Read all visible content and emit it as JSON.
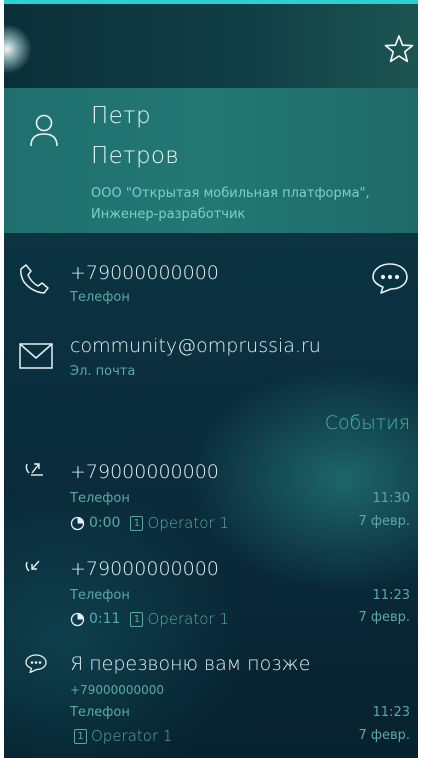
{
  "contact": {
    "first_name": "Петр",
    "last_name": "Петров",
    "company_line1": "ООО \"Открытая мобильная платформа\",",
    "company_line2": "Инженер-разработчик"
  },
  "details": {
    "phone_number": "+79000000000",
    "phone_label": "Телефон",
    "email": "community@omprussia.ru",
    "email_label": "Эл. почта"
  },
  "events_header": "События",
  "events": [
    {
      "type": "outgoing-call",
      "title": "+79000000000",
      "label": "Телефон",
      "duration": "0:00",
      "sim": "1",
      "operator": "Operator 1",
      "time": "11:30",
      "date": "7 февр."
    },
    {
      "type": "incoming-call",
      "title": "+79000000000",
      "label": "Телефон",
      "duration": "0:11",
      "sim": "1",
      "operator": "Operator 1",
      "time": "11:23",
      "date": "7 февр."
    },
    {
      "type": "message",
      "title": "Я перезвоню вам позже",
      "number": "+79000000000",
      "label": "Телефон",
      "sim": "1",
      "operator": "Operator 1",
      "time": "11:23",
      "date": "7 февр."
    }
  ],
  "icons": {
    "favorite": "star-icon",
    "avatar": "person-icon",
    "phone": "phone-icon",
    "email": "envelope-icon",
    "sms": "chat-bubble-icon",
    "outgoing": "outgoing-call-icon",
    "incoming": "incoming-call-icon",
    "duration": "timer-icon",
    "sim": "sim-card-icon"
  },
  "colors": {
    "accent": "#2ecfd0",
    "header_bg": "#237874",
    "secondary_text": "#5aa9a6",
    "events_header": "#4fb3ae"
  }
}
